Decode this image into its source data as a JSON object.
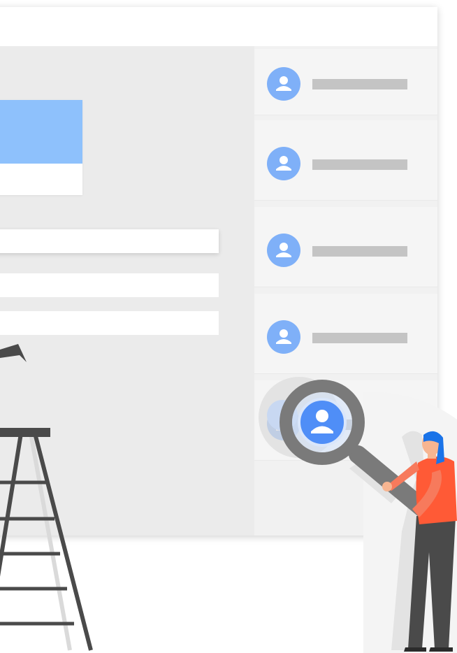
{
  "colors": {
    "accent": "#4f8ef7",
    "accent_light": "#8ec1fc",
    "avatar": "#7fb0f8",
    "placeholder_line": "#c4c4c4",
    "person_shirt": "#ff5a36",
    "person_hair": "#1a73e8",
    "person_skin": "#f7b591",
    "dark": "#4a4a4a",
    "magnifier": "#7a7a7a"
  },
  "window": {
    "list_items": [
      {
        "icon": "person-icon"
      },
      {
        "icon": "person-icon"
      },
      {
        "icon": "person-icon"
      },
      {
        "icon": "person-icon"
      },
      {
        "icon": "person-icon"
      }
    ]
  },
  "illustration": {
    "magnifier_icon": "magnifying-glass-icon",
    "highlight_icon": "person-icon",
    "ladder_icon": "ladder-icon",
    "figure": "woman-holding-magnifier"
  }
}
